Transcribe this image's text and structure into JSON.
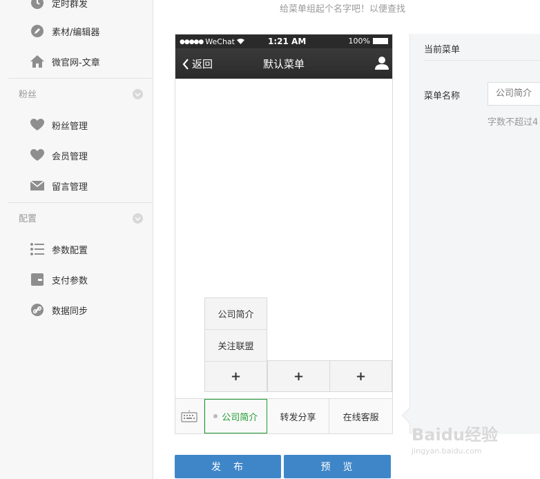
{
  "top_hint": "给菜单组起个名字吧！以便查找",
  "sidebar": {
    "items_top": [
      {
        "label": "定时群发",
        "icon": "clock-icon"
      },
      {
        "label": "素材/编辑器",
        "icon": "pencil-icon"
      },
      {
        "label": "微官网-文章",
        "icon": "home-icon"
      }
    ],
    "sections": [
      {
        "title": "粉丝",
        "items": [
          {
            "label": "粉丝管理",
            "icon": "heart-icon"
          },
          {
            "label": "会员管理",
            "icon": "heart-icon"
          },
          {
            "label": "留言管理",
            "icon": "mail-icon"
          }
        ]
      },
      {
        "title": "配置",
        "items": [
          {
            "label": "参数配置",
            "icon": "list-icon"
          },
          {
            "label": "支付参数",
            "icon": "wallet-icon"
          },
          {
            "label": "数据同步",
            "icon": "link-icon"
          }
        ]
      }
    ]
  },
  "phone": {
    "status": {
      "carrier": "WeChat",
      "time": "1:21 AM",
      "battery": "100%"
    },
    "nav": {
      "back": "返回",
      "title": "默认菜单"
    },
    "submenu": [
      "公司简介",
      "关注联盟"
    ],
    "plus": "+",
    "menu": [
      "公司简介",
      "转发分享",
      "在线客服"
    ]
  },
  "buttons": {
    "publish": "发　布",
    "preview": "预　览"
  },
  "panel": {
    "heading": "当前菜单",
    "name_label": "菜单名称",
    "name_value": "公司简介",
    "tip": "字数不超过4"
  },
  "watermark": {
    "main": "Baidu经验",
    "sub": "jingyan.baidu.com"
  },
  "colors": {
    "accent_green": "#1e9b30",
    "button_blue": "#3f86c9",
    "nav_dark": "#2b2b2b"
  }
}
